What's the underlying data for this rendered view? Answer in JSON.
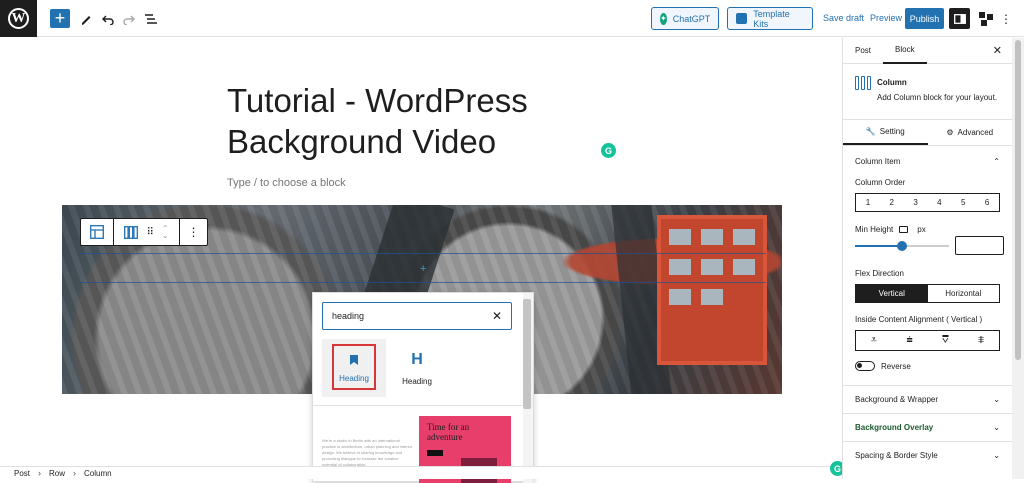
{
  "toolbar": {
    "add_icon": "plus-icon",
    "chatgpt_label": "ChatGPT",
    "template_kits_label": "Template Kits",
    "save_draft_label": "Save draft",
    "preview_label": "Preview",
    "publish_label": "Publish"
  },
  "post": {
    "title": "Tutorial - WordPress Background Video",
    "placeholder": "Type / to choose a block"
  },
  "inserter": {
    "search_value": "heading",
    "results": [
      {
        "label": "Heading"
      },
      {
        "label": "Heading"
      }
    ],
    "pattern_title": "Time for an adventure",
    "pattern_text": "We're a studio in Berlin with an international practice in architecture, urban planning and interior design. We believe in sharing knowledge and promoting dialogue to increase the creative potential of collaboration."
  },
  "breadcrumb": [
    "Post",
    "Row",
    "Column"
  ],
  "sidebar": {
    "tabs": [
      "Post",
      "Block"
    ],
    "block_name": "Column",
    "block_desc": "Add Column block for your layout.",
    "subtabs": [
      "Setting",
      "Advanced"
    ],
    "panel_title": "Column Item",
    "column_order_label": "Column Order",
    "column_order_options": [
      "1",
      "2",
      "3",
      "4",
      "5",
      "6"
    ],
    "min_height_label": "Min Height",
    "min_height_unit": "px",
    "flex_direction_label": "Flex Direction",
    "flex_direction_options": [
      "Vertical",
      "Horizontal"
    ],
    "flex_direction_selected": "Vertical",
    "inside_alignment_label": "Inside Content Alignment ( Vertical )",
    "reverse_label": "Reverse",
    "collapsed_panels": [
      "Background & Wrapper",
      "Background Overlay",
      "Spacing & Border Style"
    ]
  },
  "colors": {
    "accent": "#2271b1",
    "dark": "#1e1e1e",
    "highlight_red": "#d63638",
    "grammarly_green": "#15c39a"
  }
}
